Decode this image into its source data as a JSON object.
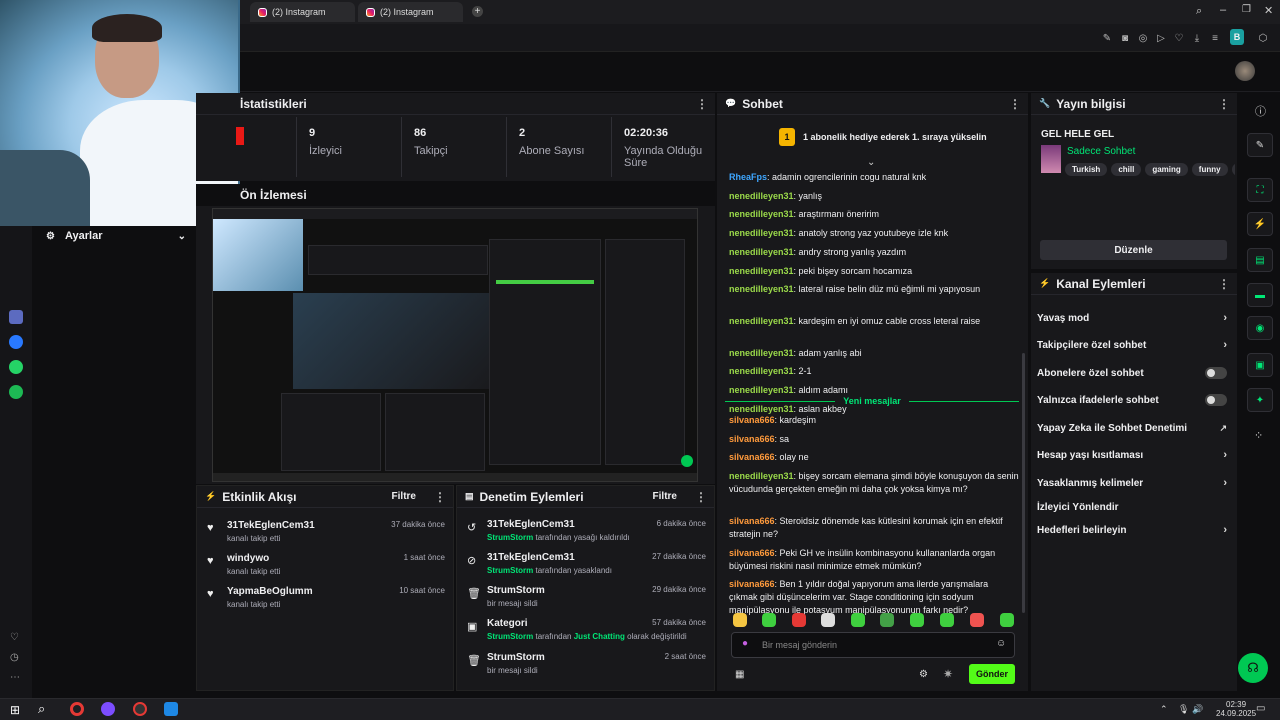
{
  "browser": {
    "tabs": [
      {
        "label": "(2) Instagram"
      },
      {
        "label": "(2) Instagram"
      }
    ],
    "new_tab_icon": "plus-icon",
    "profile_initial": "B"
  },
  "stats": {
    "title": "İstatistikleri",
    "items": [
      {
        "value": "9",
        "label": "İzleyici"
      },
      {
        "value": "86",
        "label": "Takipçi"
      },
      {
        "value": "2",
        "label": "Abone Sayısı"
      },
      {
        "value": "02:20:36",
        "label": "Yayında Olduğu Süre"
      }
    ]
  },
  "settings": {
    "title": "Ayarlar"
  },
  "preview": {
    "title": "Ön İzlemesi"
  },
  "activity": {
    "title": "Etkinlik Akışı",
    "filter": "Filtre",
    "events": [
      {
        "name": "31TekEglenCem31",
        "sub": "kanalı takip etti",
        "time": "37 dakika önce"
      },
      {
        "name": "windywo",
        "sub": "kanalı takip etti",
        "time": "1 saat önce"
      },
      {
        "name": "YapmaBeOglumm",
        "sub": "kanalı takip etti",
        "time": "10 saat önce"
      }
    ]
  },
  "moderation": {
    "title": "Denetim Eylemleri",
    "filter": "Filtre",
    "events": [
      {
        "name": "31TekEglenCem31",
        "actor": "StrumStorm",
        "sub": "tarafından yasağı kaldırıldı",
        "time": "6 dakika önce"
      },
      {
        "name": "31TekEglenCem31",
        "actor": "StrumStorm",
        "sub": "tarafından yasaklandı",
        "time": "27 dakika önce"
      },
      {
        "name": "StrumStorm",
        "actor": "",
        "sub": "bir mesajı sildi",
        "time": "29 dakika önce"
      },
      {
        "name": "Kategori",
        "actor": "StrumStorm",
        "sub": "tarafından",
        "extra": "Just Chatting",
        "tail": "olarak değiştirildi",
        "time": "57 dakika önce"
      },
      {
        "name": "StrumStorm",
        "actor": "",
        "sub": "bir mesajı sildi",
        "time": "2 saat önce"
      }
    ]
  },
  "chat": {
    "title": "Sohbet",
    "sub_goal": "1 abonelik hediye ederek 1. sıraya yükselin",
    "sub_goal_badge": "1",
    "new_messages": "Yeni mesajlar",
    "input_placeholder": "Bir mesaj gönderin",
    "send": "Gönder",
    "messages": [
      {
        "user": "RheaFps",
        "text": ": adamin ogrencilerinin cogu natural knk",
        "color": "u3"
      },
      {
        "user": "nenedilleyen31",
        "text": ": yanlış",
        "color": "u1"
      },
      {
        "user": "nenedilleyen31",
        "text": ": araştırmanı öneririm",
        "color": "u1"
      },
      {
        "user": "nenedilleyen31",
        "text": ": anatoly strong yaz youtubeye izle knk",
        "color": "u1"
      },
      {
        "user": "nenedilleyen31",
        "text": ": andry strong yanlış yazdım",
        "color": "u1"
      },
      {
        "user": "nenedilleyen31",
        "text": ": peki bişey sorcam hocamıza",
        "color": "u1"
      },
      {
        "user": "nenedilleyen31",
        "text": ": lateral raise belin düz mü eğimli mi yapıyosun",
        "color": "u1"
      },
      {
        "user": "nenedilleyen31",
        "text": ": kardeşim en iyi omuz cable cross leteral raise",
        "color": "u1"
      },
      {
        "user": "nenedilleyen31",
        "text": ": adam yanlış abi",
        "color": "u1"
      },
      {
        "user": "nenedilleyen31",
        "text": ": 2-1",
        "color": "u1"
      },
      {
        "user": "nenedilleyen31",
        "text": ": aldım adamı",
        "color": "u1"
      },
      {
        "user": "nenedilleyen31",
        "text": ": aslan akbey",
        "color": "u1"
      }
    ],
    "new_msgs": [
      {
        "user": "silvana666",
        "text": ": kardeşim",
        "color": "u2"
      },
      {
        "user": "silvana666",
        "text": ": sa",
        "color": "u2"
      },
      {
        "user": "silvana666",
        "text": ": olay ne",
        "color": "u2"
      },
      {
        "user": "nenedilleyen31",
        "text": ": bişey sorcam elemana şimdi böyle konuşuyon da senin vücudunda gerçekten emeğin mi daha çok yoksa kimya mı?",
        "color": "u1"
      },
      {
        "user": "silvana666",
        "text": ": Steroidsiz dönemde kas kütlesini korumak için en efektif stratejin ne?",
        "color": "u2"
      },
      {
        "user": "silvana666",
        "text": ": Peki GH ve insülin kombinasyonu kullananlarda organ büyümesi riskini nasıl minimize etmek mümkün?",
        "color": "u2"
      },
      {
        "user": "silvana666",
        "text": ": Ben 1 yıldır doğal yapıyorum ama ilerde yarışmalara çıkmak gibi düşüncelerim var. Stage conditioning için sodyum manipülasyonu ile potasyum manipülasyonunun farkı nedir?",
        "color": "u2"
      }
    ]
  },
  "stream_info": {
    "title": "Yayın bilgisi",
    "stream_title": "GEL HELE GEL",
    "category": "Sadece Sohbet",
    "tags": [
      "Turkish",
      "chill",
      "gaming",
      "funny",
      "de"
    ],
    "edit": "Düzenle"
  },
  "channel_actions": {
    "title": "Kanal Eylemleri",
    "items": [
      {
        "label": "Yavaş mod",
        "kind": "chevron"
      },
      {
        "label": "Takipçilere özel sohbet",
        "kind": "chevron"
      },
      {
        "label": "Abonelere özel sohbet",
        "kind": "toggle"
      },
      {
        "label": "Yalnızca ifadelerle sohbet",
        "kind": "toggle"
      },
      {
        "label": "Yapay Zeka ile Sohbet Denetimi",
        "kind": "external"
      },
      {
        "label": "Hesap yaşı kısıtlaması",
        "kind": "chevron"
      },
      {
        "label": "Yasaklanmış kelimeler",
        "kind": "chevron"
      },
      {
        "label": "İzleyici Yönlendir",
        "kind": "none"
      },
      {
        "label": "Hedefleri belirleyin",
        "kind": "chevron"
      }
    ]
  },
  "taskbar": {
    "time": "02:39",
    "date": "24.09.2025"
  }
}
